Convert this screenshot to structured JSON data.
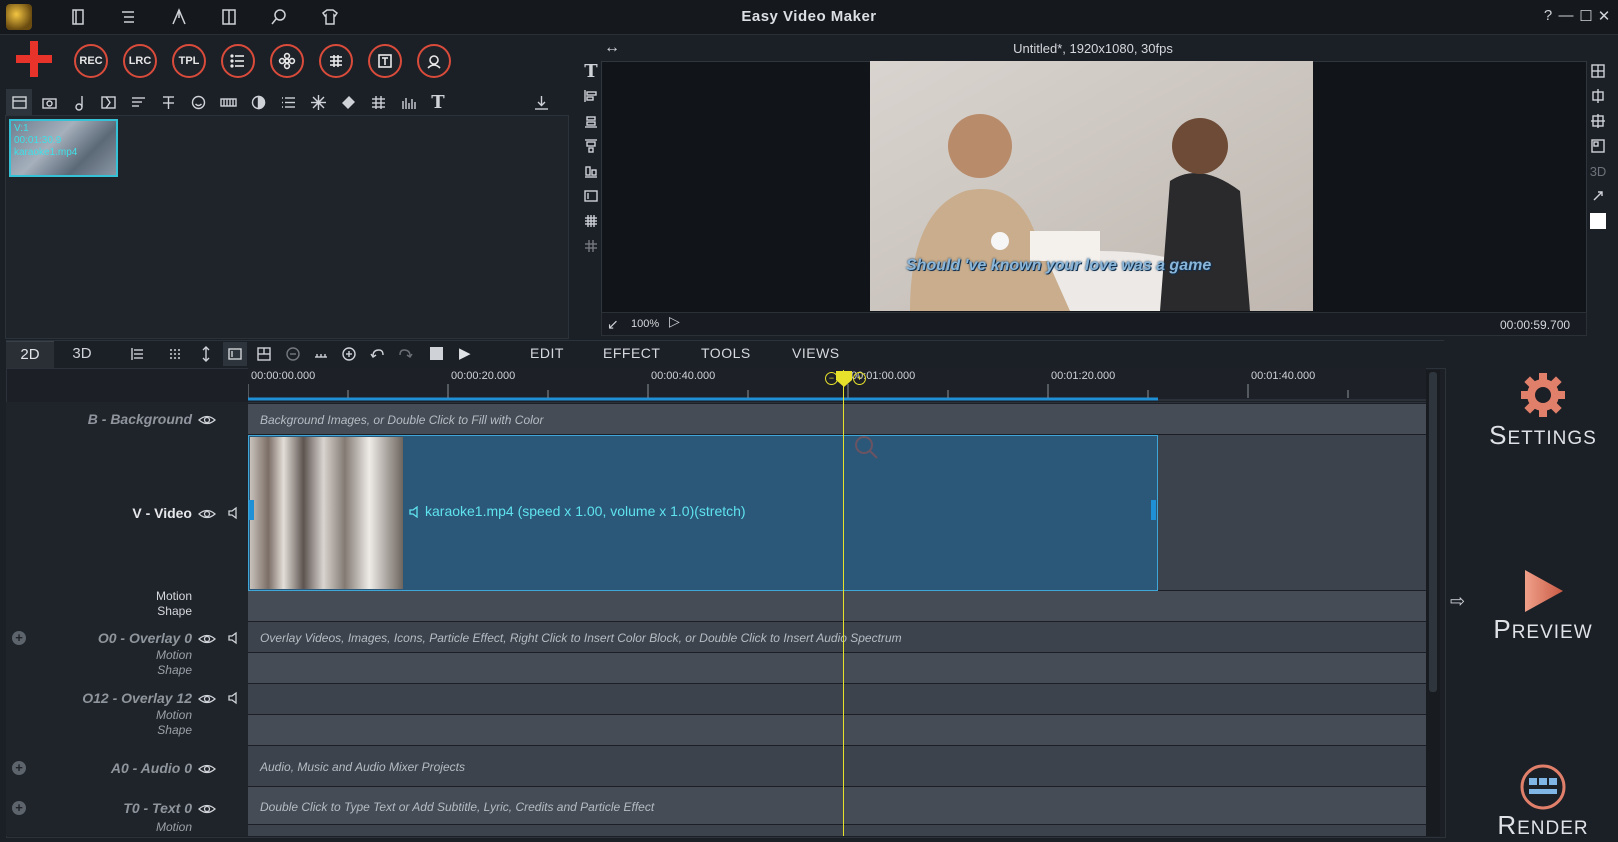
{
  "app": {
    "title": "Easy Video Maker"
  },
  "window_controls": [
    "?",
    "—",
    "☐",
    "✕"
  ],
  "top_round_buttons": [
    "REC",
    "LRC",
    "TPL"
  ],
  "media": {
    "thumb": {
      "track": "V:1",
      "duration": "00:01:30.9",
      "filename": "karaoke1.mp4"
    }
  },
  "preview": {
    "title": "Untitled*, 1920x1080, 30fps",
    "zoom": "100%",
    "timecode": "00:00:59.700",
    "subtitle": "Should 've known your love was a game"
  },
  "timeline_tabs": [
    "2D",
    "3D"
  ],
  "timeline_menu": [
    "EDIT",
    "EFFECT",
    "TOOLS",
    "VIEWS"
  ],
  "ruler": [
    "00:00:00.000",
    "00:00:20.000",
    "00:00:40.000",
    "00:01:00.000",
    "00:01:20.000",
    "00:01:40.000"
  ],
  "tracks": {
    "background": {
      "name": "B - Background",
      "hint": "Background Images, or Double Click to Fill with Color"
    },
    "video": {
      "name": "V - Video",
      "motion": "Motion",
      "shape": "Shape",
      "clip": "karaoke1.mp4  (speed x 1.00, volume x 1.0)(stretch)"
    },
    "overlay0": {
      "name": "O0 - Overlay 0",
      "motion": "Motion",
      "shape": "Shape",
      "hint": "Overlay Videos, Images, Icons, Particle Effect, Right Click to Insert Color Block, or Double Click to Insert Audio Spectrum"
    },
    "overlay12": {
      "name": "O12 - Overlay 12",
      "motion": "Motion",
      "shape": "Shape"
    },
    "audio0": {
      "name": "A0 - Audio 0",
      "hint": "Audio, Music and Audio Mixer Projects"
    },
    "text0": {
      "name": "T0 - Text 0",
      "motion": "Motion",
      "hint": "Double Click to Type Text or Add Subtitle, Lyric, Credits and Particle Effect"
    }
  },
  "actions": {
    "settings": {
      "first": "S",
      "rest": "ETTINGS"
    },
    "preview": {
      "first": "P",
      "rest": "REVIEW"
    },
    "render": {
      "first": "R",
      "rest": "ENDER"
    }
  },
  "colors": {
    "accent_red": "#d94b3a",
    "playhead": "#e8e12c",
    "clip_border": "#3fa6d8",
    "clip_text": "#5fe3f0"
  }
}
